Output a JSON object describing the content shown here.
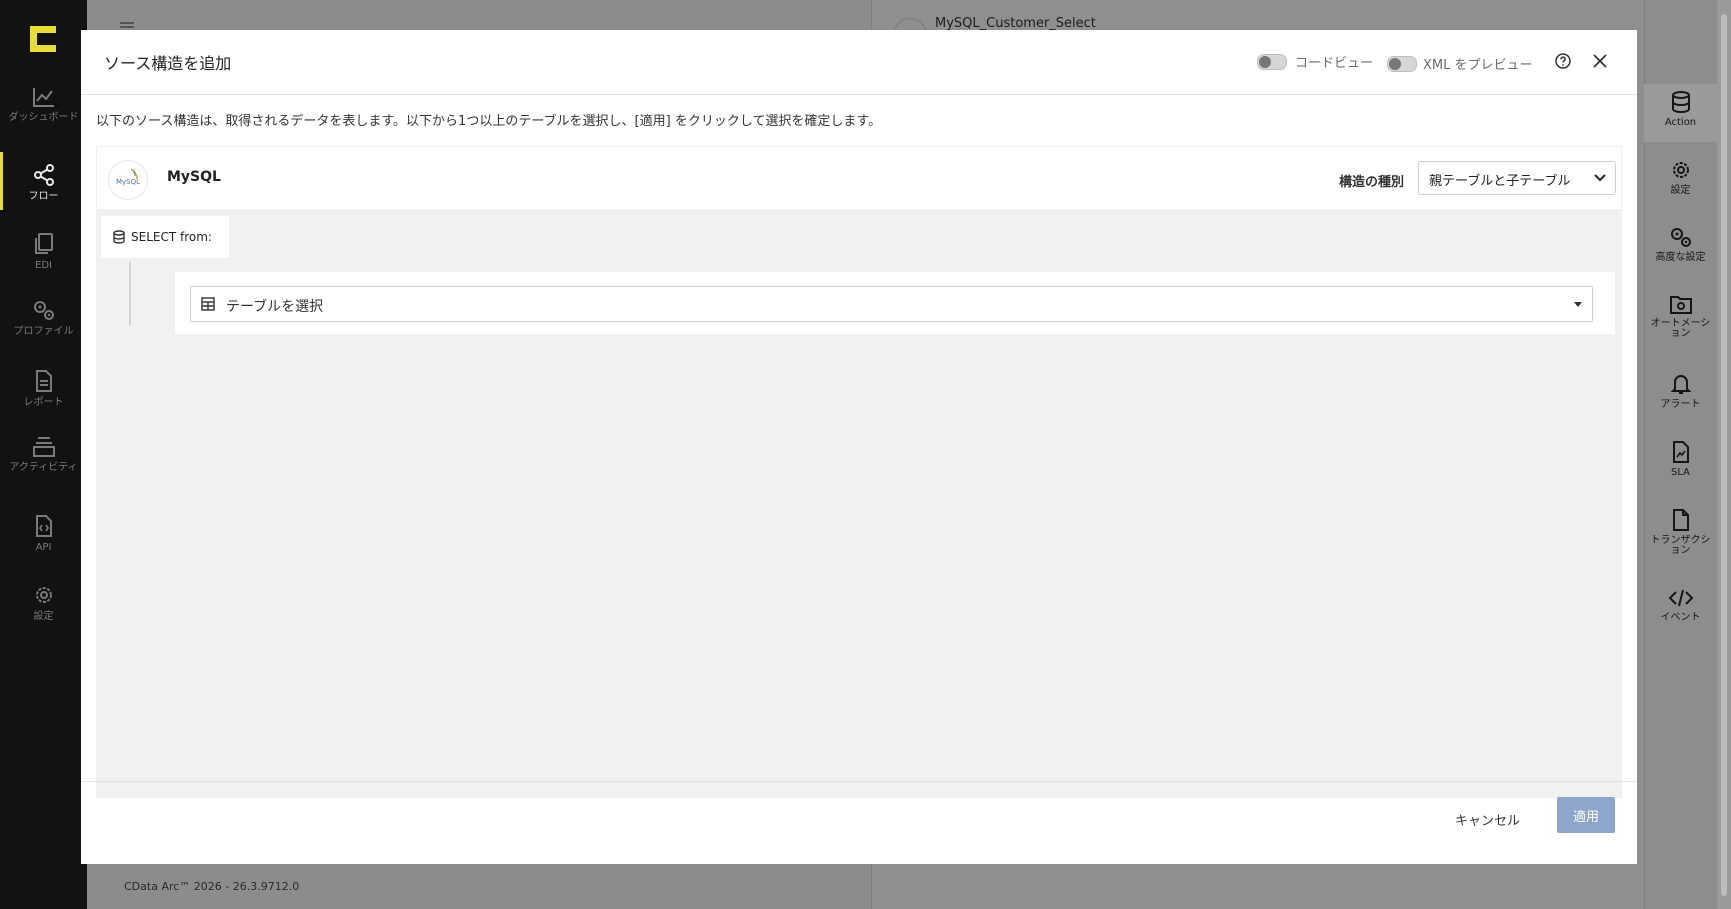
{
  "app": {
    "version": "CData Arc™ 2026 - 26.3.9712.0",
    "flow_title": "MySQL_Customer_Select"
  },
  "left_nav": {
    "items": [
      {
        "label": "ダッシュボード",
        "icon": "chart-line-icon"
      },
      {
        "label": "フロー",
        "icon": "share-nodes-icon",
        "active": true
      },
      {
        "label": "EDI",
        "icon": "copy-files-icon"
      },
      {
        "label": "プロファイル",
        "icon": "gears-icon"
      },
      {
        "label": "レポート",
        "icon": "file-text-icon"
      },
      {
        "label": "アクティビティ",
        "icon": "layers-icon"
      },
      {
        "label": "API",
        "icon": "file-code-icon"
      },
      {
        "label": "設定",
        "icon": "gear-icon"
      }
    ]
  },
  "right_nav": {
    "items": [
      {
        "label": "Action",
        "icon": "database-icon",
        "active": true
      },
      {
        "label": "設定",
        "icon": "gear-icon"
      },
      {
        "label": "高度な設定",
        "icon": "gears-icon"
      },
      {
        "label": "オートメーション",
        "icon": "folder-gear-icon"
      },
      {
        "label": "アラート",
        "icon": "bell-icon"
      },
      {
        "label": "SLA",
        "icon": "file-chart-icon"
      },
      {
        "label": "トランザクション",
        "icon": "file-icon"
      },
      {
        "label": "イベント",
        "icon": "code-icon"
      }
    ]
  },
  "modal": {
    "title": "ソース構造を追加",
    "code_view_label": "コードビュー",
    "xml_preview_label": "XML をプレビュー",
    "description": "以下のソース構造は、取得されるデータを表します。以下から1つ以上のテーブルを選択し、[適用] をクリックして選択を確定します。",
    "source": {
      "name": "MySQL",
      "logo_text": "MySQL",
      "structure_type_label": "構造の種別",
      "structure_type_value": "親テーブルと子テーブル",
      "select_from_label": "SELECT from:",
      "table_placeholder": "テーブルを選択"
    },
    "footer": {
      "cancel_label": "キャンセル",
      "apply_label": "適用"
    }
  },
  "colors": {
    "accent_yellow": "#e8dd3a",
    "apply_button": "#8ea6cc",
    "left_nav_bg": "#121212"
  }
}
